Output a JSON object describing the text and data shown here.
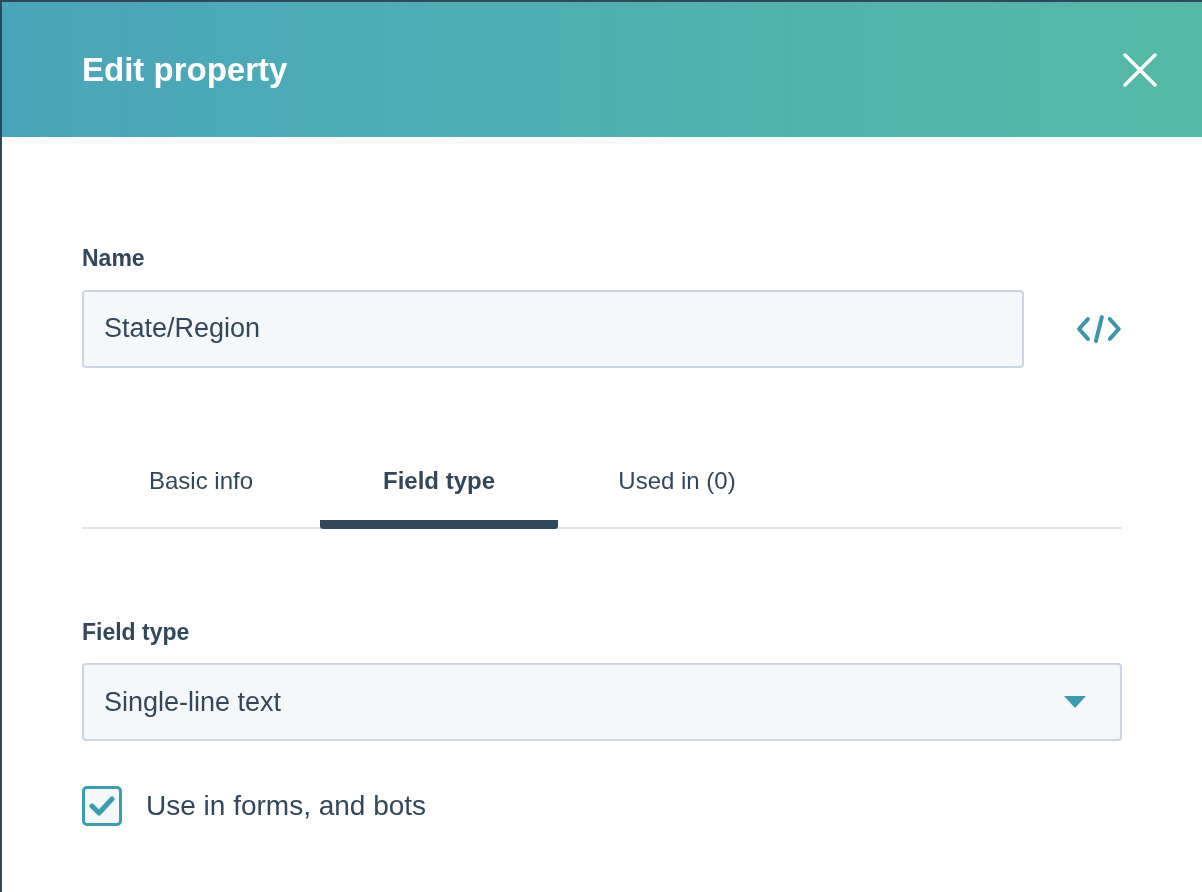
{
  "dialog": {
    "title": "Edit property"
  },
  "name_field": {
    "label": "Name",
    "value": "State/Region"
  },
  "tabs": [
    {
      "label": "Basic info",
      "selected": false
    },
    {
      "label": "Field type",
      "selected": true
    },
    {
      "label": "Used in (0)",
      "selected": false
    }
  ],
  "field_type": {
    "label": "Field type",
    "value": "Single-line text"
  },
  "use_in_forms": {
    "label": "Use in forms, and bots",
    "checked": true
  }
}
